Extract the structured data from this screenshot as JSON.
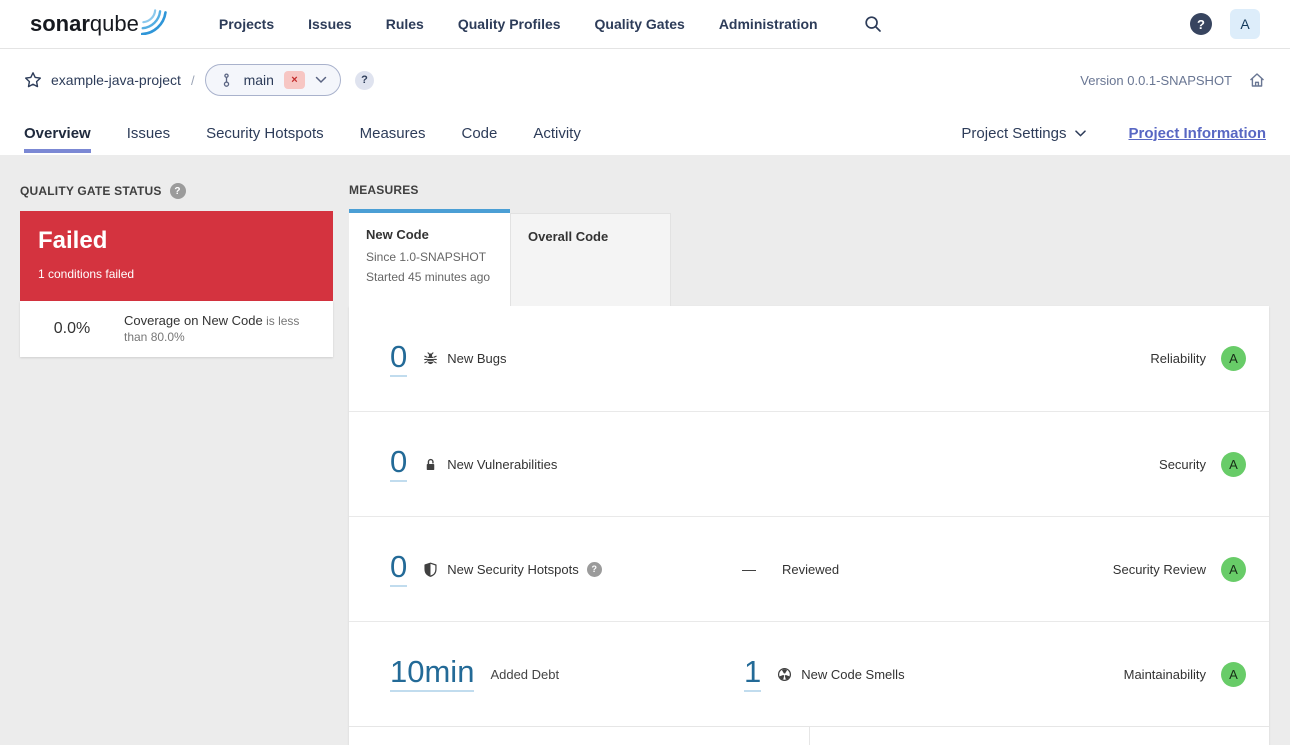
{
  "nav": {
    "logo_bold": "sonar",
    "logo_light": "qube",
    "items": [
      "Projects",
      "Issues",
      "Rules",
      "Quality Profiles",
      "Quality Gates",
      "Administration"
    ],
    "avatar_initial": "A"
  },
  "breadcrumb": {
    "project_name": "example-java-project",
    "separator": "/",
    "branch_name": "main",
    "version_label": "Version 0.0.1-SNAPSHOT"
  },
  "tabs": {
    "items": [
      "Overview",
      "Issues",
      "Security Hotspots",
      "Measures",
      "Code",
      "Activity"
    ],
    "active": "Overview",
    "project_settings_label": "Project Settings",
    "project_information_label": "Project Information"
  },
  "quality_gate": {
    "section_title": "QUALITY GATE STATUS",
    "status_label": "Failed",
    "conditions_summary": "1 conditions failed",
    "condition": {
      "value": "0.0%",
      "metric": "Coverage on New Code",
      "comparator": "is less than 80.0%"
    }
  },
  "measures": {
    "section_title": "MEASURES",
    "tab_new_code": {
      "label": "New Code",
      "since": "Since 1.0-SNAPSHOT",
      "started": "Started 45 minutes ago"
    },
    "tab_overall_code": {
      "label": "Overall Code"
    },
    "rows": [
      {
        "value": "0",
        "label": "New Bugs",
        "domain": "Reliability",
        "rating": "A"
      },
      {
        "value": "0",
        "label": "New Vulnerabilities",
        "domain": "Security",
        "rating": "A"
      },
      {
        "value": "0",
        "label": "New Security Hotspots",
        "reviewed_dash": "—",
        "reviewed_label": "Reviewed",
        "domain": "Security Review",
        "rating": "A"
      },
      {
        "value": "10min",
        "label": "Added Debt",
        "value2": "1",
        "label2": "New Code Smells",
        "domain": "Maintainability",
        "rating": "A"
      }
    ]
  },
  "icons": {
    "help_glyph": "?",
    "close_glyph": "×",
    "star": "svg-star-outline",
    "branch": "svg-commit-branch",
    "chevron_down": "svg-chevron",
    "search": "svg-magnifier",
    "home": "svg-house",
    "bug": "svg-bug",
    "lock_open": "svg-open-padlock",
    "shield": "svg-half-shield",
    "code_smell": "svg-pie-circle",
    "logo_swoosh": "three-blue-arcs"
  },
  "colors": {
    "failed_red": "#d4333f",
    "rating_green": "#68cc68",
    "measure_link_blue": "#236a97",
    "active_tab_blue": "#4b9fd5",
    "accent_indigo": "#7b88d4",
    "link_indigo": "#5867c3",
    "navy_text": "#2d3c59"
  }
}
